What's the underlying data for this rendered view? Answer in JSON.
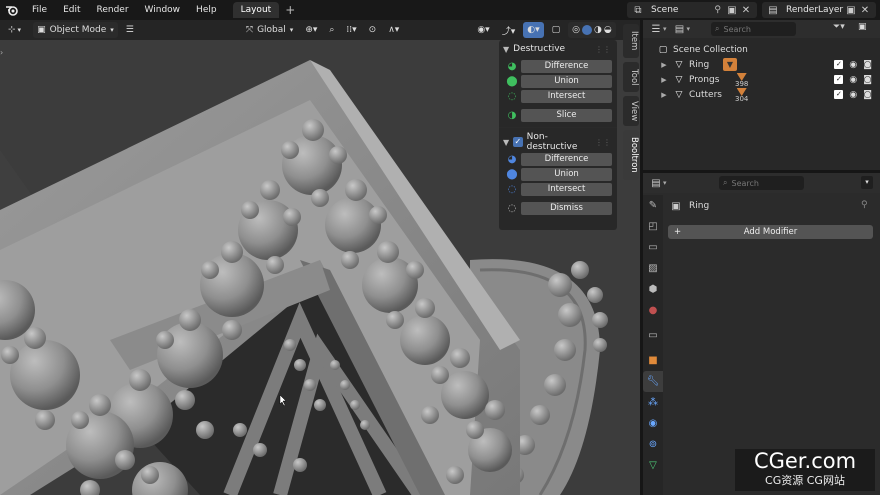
{
  "topbar": {
    "menus": [
      "File",
      "Edit",
      "Render",
      "Window",
      "Help"
    ],
    "workspace_tab": "Layout",
    "add_tab": "+",
    "scene": "Scene",
    "view_layer": "RenderLayer"
  },
  "viewport": {
    "mode": "Object Mode",
    "transform_orientation": "Global"
  },
  "sidebar_tabs": [
    "Item",
    "Tool",
    "View",
    "Booltron"
  ],
  "booltron": {
    "destructive": {
      "title": "Destructive",
      "buttons": [
        "Difference",
        "Union",
        "Intersect",
        "Slice"
      ]
    },
    "non_destructive": {
      "title": "Non-destructive",
      "buttons": [
        "Difference",
        "Union",
        "Intersect",
        "Dismiss"
      ]
    }
  },
  "outliner": {
    "search_placeholder": "Search",
    "collection": "Scene Collection",
    "items": [
      {
        "name": "Ring",
        "badge": ""
      },
      {
        "name": "Prongs",
        "badge": "398"
      },
      {
        "name": "Cutters",
        "badge": "304"
      }
    ]
  },
  "properties": {
    "search_placeholder": "Search",
    "object_name": "Ring",
    "add_modifier": "Add Modifier"
  },
  "watermark": {
    "main": "CGer.com",
    "sub": "CG资源 CG网站"
  },
  "colors": {
    "accent": "#4772b3",
    "boolean_green": "#3fbf5f",
    "boolean_blue": "#4f86e0",
    "modifier_orange": "#d3813a"
  }
}
